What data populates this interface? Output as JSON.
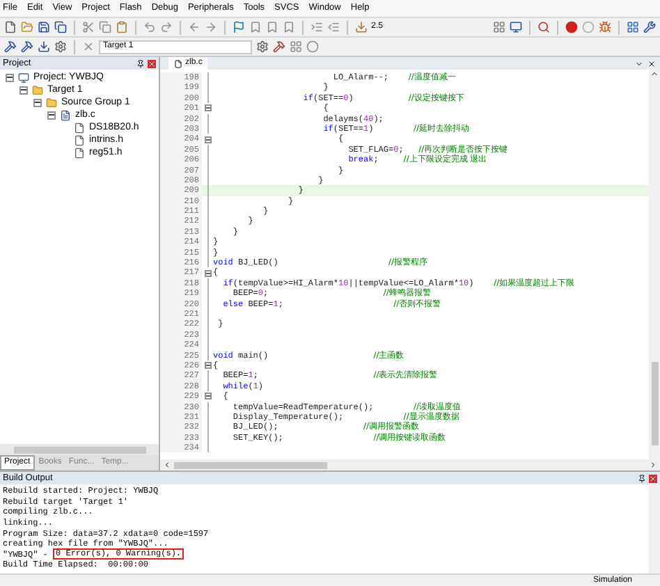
{
  "menu": [
    "File",
    "Edit",
    "View",
    "Project",
    "Flash",
    "Debug",
    "Peripherals",
    "Tools",
    "SVCS",
    "Window",
    "Help"
  ],
  "toolbar": {
    "zoom_value": "2.5",
    "target": "Target 1"
  },
  "project_panel": {
    "title": "Project",
    "tree": [
      {
        "label": "Project: YWBJQ",
        "kind": "project",
        "expanded": true,
        "children": [
          {
            "label": "Target 1",
            "kind": "target",
            "expanded": true,
            "children": [
              {
                "label": "Source Group 1",
                "kind": "group",
                "expanded": true,
                "children": [
                  {
                    "label": "zlb.c",
                    "kind": "file",
                    "expanded": true,
                    "children": [
                      {
                        "label": "DS18B20.h",
                        "kind": "header"
                      },
                      {
                        "label": "intrins.h",
                        "kind": "header"
                      },
                      {
                        "label": "reg51.h",
                        "kind": "header"
                      }
                    ]
                  }
                ]
              }
            ]
          }
        ]
      }
    ],
    "tabs": [
      {
        "label": "Project",
        "selected": true
      },
      {
        "label": "Books",
        "selected": false
      },
      {
        "label": "Func...",
        "selected": false
      },
      {
        "label": "Temp...",
        "selected": false
      }
    ]
  },
  "editor": {
    "tab": "zlb.c",
    "lines": [
      {
        "number": "198",
        "fold": false,
        "current": false,
        "tokens": [
          {
            "t": "LO_Alarm--;",
            "kind": "plain"
          }
        ],
        "comment": "//温度值减一"
      },
      {
        "number": "199",
        "fold": false,
        "current": false,
        "tokens": [
          {
            "t": "}",
            "kind": "plain"
          }
        ]
      },
      {
        "number": "200",
        "fold": false,
        "current": false,
        "tokens": [
          {
            "t": "if",
            "kind": "keyword"
          },
          {
            "t": "(SET==",
            "kind": "plain"
          },
          {
            "t": "0",
            "kind": "number"
          },
          {
            "t": ")",
            "kind": "plain"
          }
        ],
        "comment": "//设定按键按下"
      },
      {
        "number": "201",
        "fold": true,
        "current": false,
        "tokens": [
          {
            "t": "{",
            "kind": "plain"
          }
        ]
      },
      {
        "number": "202",
        "fold": false,
        "current": false,
        "tokens": [
          {
            "t": "delayms(",
            "kind": "plain"
          },
          {
            "t": "40",
            "kind": "number"
          },
          {
            "t": ");",
            "kind": "plain"
          }
        ]
      },
      {
        "number": "203",
        "fold": false,
        "current": false,
        "tokens": [
          {
            "t": "if",
            "kind": "keyword"
          },
          {
            "t": "(SET==",
            "kind": "plain"
          },
          {
            "t": "1",
            "kind": "number"
          },
          {
            "t": ")",
            "kind": "plain"
          }
        ],
        "comment": "//延时去除抖动"
      },
      {
        "number": "204",
        "fold": true,
        "current": false,
        "tokens": [
          {
            "t": "{",
            "kind": "plain"
          }
        ]
      },
      {
        "number": "205",
        "fold": false,
        "current": false,
        "tokens": [
          {
            "t": "SET_FLAG=",
            "kind": "plain"
          },
          {
            "t": "0",
            "kind": "number"
          },
          {
            "t": ";",
            "kind": "plain"
          }
        ],
        "comment": "//再次判断是否按下按键"
      },
      {
        "number": "206",
        "fold": false,
        "current": false,
        "tokens": [
          {
            "t": "break",
            "kind": "keyword"
          },
          {
            "t": ";",
            "kind": "plain"
          }
        ],
        "comment": "//上下限设定完成 退出"
      },
      {
        "number": "207",
        "fold": false,
        "current": false,
        "tokens": [
          {
            "t": "}",
            "kind": "plain"
          }
        ]
      },
      {
        "number": "208",
        "fold": false,
        "current": false,
        "tokens": [
          {
            "t": "}",
            "kind": "plain"
          }
        ]
      },
      {
        "number": "209",
        "fold": false,
        "current": true,
        "tokens": [
          {
            "t": "}",
            "kind": "plain"
          }
        ]
      },
      {
        "number": "210",
        "fold": false,
        "current": false,
        "tokens": [
          {
            "t": "}",
            "kind": "plain"
          }
        ]
      },
      {
        "number": "211",
        "fold": false,
        "current": false,
        "tokens": [
          {
            "t": "}",
            "kind": "plain"
          }
        ]
      },
      {
        "number": "212",
        "fold": false,
        "current": false,
        "tokens": [
          {
            "t": "}",
            "kind": "plain"
          }
        ]
      },
      {
        "number": "213",
        "fold": false,
        "current": false,
        "tokens": [
          {
            "t": "}",
            "kind": "plain"
          }
        ]
      },
      {
        "number": "214",
        "fold": false,
        "current": false,
        "tokens": [
          {
            "t": "}",
            "kind": "plain"
          }
        ]
      },
      {
        "number": "215",
        "fold": false,
        "current": false,
        "tokens": [
          {
            "t": "}",
            "kind": "plain"
          }
        ]
      },
      {
        "number": "216",
        "fold": false,
        "current": false,
        "tokens": [
          {
            "t": "void",
            "kind": "keyword"
          },
          {
            "t": " BJ_LED()",
            "kind": "plain"
          }
        ],
        "comment": "//报警程序"
      },
      {
        "number": "217",
        "fold": true,
        "current": false,
        "tokens": [
          {
            "t": "{",
            "kind": "plain"
          }
        ]
      },
      {
        "number": "218",
        "fold": false,
        "current": false,
        "tokens": [
          {
            "t": "if",
            "kind": "keyword"
          },
          {
            "t": "(tempValue>=HI_Alarm*",
            "kind": "plain"
          },
          {
            "t": "10",
            "kind": "number"
          },
          {
            "t": "||tempValue<=LO_Alarm*",
            "kind": "plain"
          },
          {
            "t": "10",
            "kind": "number"
          },
          {
            "t": ")",
            "kind": "plain"
          }
        ],
        "comment": "//如果温度超过上下限"
      },
      {
        "number": "219",
        "fold": false,
        "current": false,
        "tokens": [
          {
            "t": "BEEP=",
            "kind": "plain"
          },
          {
            "t": "0",
            "kind": "number"
          },
          {
            "t": ";",
            "kind": "plain"
          }
        ],
        "comment": "//蜂鸣器报警"
      },
      {
        "number": "220",
        "fold": false,
        "current": false,
        "tokens": [
          {
            "t": "else",
            "kind": "keyword"
          },
          {
            "t": " BEEP=",
            "kind": "plain"
          },
          {
            "t": "1",
            "kind": "number"
          },
          {
            "t": ";",
            "kind": "plain"
          }
        ],
        "comment": "//否则不报警"
      },
      {
        "number": "221",
        "fold": false,
        "current": false
      },
      {
        "number": "222",
        "fold": false,
        "current": false,
        "tokens": [
          {
            "t": "}",
            "kind": "plain"
          }
        ]
      },
      {
        "number": "223",
        "fold": false,
        "current": false
      },
      {
        "number": "224",
        "fold": false,
        "current": false
      },
      {
        "number": "225",
        "fold": false,
        "current": false,
        "tokens": [
          {
            "t": "void",
            "kind": "keyword"
          },
          {
            "t": " main()",
            "kind": "plain"
          }
        ],
        "comment": "//主函数"
      },
      {
        "number": "226",
        "fold": true,
        "current": false,
        "tokens": [
          {
            "t": "{",
            "kind": "plain"
          }
        ]
      },
      {
        "number": "227",
        "fold": false,
        "current": false,
        "tokens": [
          {
            "t": "BEEP=",
            "kind": "plain"
          },
          {
            "t": "1",
            "kind": "number"
          },
          {
            "t": ";",
            "kind": "plain"
          }
        ],
        "comment": "//表示先清除报警"
      },
      {
        "number": "228",
        "fold": false,
        "current": false,
        "tokens": [
          {
            "t": "while",
            "kind": "keyword"
          },
          {
            "t": "(",
            "kind": "plain"
          },
          {
            "t": "1",
            "kind": "number"
          },
          {
            "t": ")",
            "kind": "plain"
          }
        ]
      },
      {
        "number": "229",
        "fold": true,
        "current": false,
        "tokens": [
          {
            "t": "{",
            "kind": "plain"
          }
        ]
      },
      {
        "number": "230",
        "fold": false,
        "current": false,
        "tokens": [
          {
            "t": "tempValue=ReadTemperature();",
            "kind": "plain"
          }
        ],
        "comment": "//读取温度值"
      },
      {
        "number": "231",
        "fold": false,
        "current": false,
        "tokens": [
          {
            "t": "Display_Temperature();",
            "kind": "plain"
          }
        ],
        "comment": "//显示温度数据"
      },
      {
        "number": "232",
        "fold": false,
        "current": false,
        "tokens": [
          {
            "t": "BJ_LED();",
            "kind": "plain"
          }
        ],
        "comment": "//调用报警函数"
      },
      {
        "number": "233",
        "fold": false,
        "current": false,
        "tokens": [
          {
            "t": "SET_KEY();",
            "kind": "plain"
          }
        ],
        "comment": "//调用按键读取函数"
      },
      {
        "number": "234",
        "fold": false,
        "current": false
      }
    ]
  },
  "build_output": {
    "title": "Build Output",
    "lines": [
      {
        "text": "Rebuild started: Project: YWBJQ"
      },
      {
        "text": "Rebuild target 'Target 1'"
      },
      {
        "text": "compiling zlb.c..."
      },
      {
        "text": "linking..."
      },
      {
        "text": "Program Size: data=37.2 xdata=0 code=1597"
      },
      {
        "text": "creating hex file from \"YWBJQ\"..."
      },
      {
        "text": "\"YWBJQ\" - ",
        "boxed": "0 Error(s), 0 Warning(s)."
      },
      {
        "text": "Build Time Elapsed:  00:00:00"
      }
    ]
  },
  "status_bar": {
    "mode": "Simulation"
  }
}
